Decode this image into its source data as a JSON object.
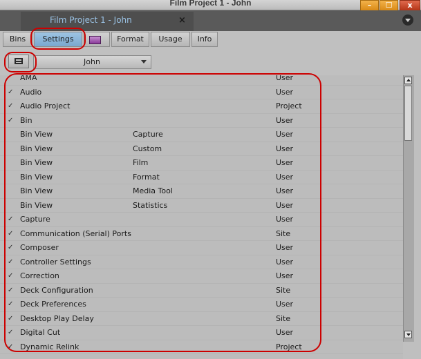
{
  "window": {
    "title": "Film Project 1 - John",
    "min_label": "–",
    "max_label": "☐",
    "close_label": "x"
  },
  "project_tab": {
    "label": "Film Project 1 - John",
    "close_label": "×"
  },
  "tabs": [
    {
      "label": "Bins"
    },
    {
      "label": "Settings"
    },
    {
      "label": ""
    },
    {
      "label": "Format"
    },
    {
      "label": "Usage"
    },
    {
      "label": "Info"
    }
  ],
  "user_select": {
    "value": "John"
  },
  "settings": [
    {
      "checked": false,
      "name": "AMA",
      "sub": "",
      "type": "User"
    },
    {
      "checked": true,
      "name": "Audio",
      "sub": "",
      "type": "User"
    },
    {
      "checked": true,
      "name": "Audio Project",
      "sub": "",
      "type": "Project"
    },
    {
      "checked": true,
      "name": "Bin",
      "sub": "",
      "type": "User"
    },
    {
      "checked": false,
      "name": "Bin View",
      "sub": "Capture",
      "type": "User"
    },
    {
      "checked": false,
      "name": "Bin View",
      "sub": "Custom",
      "type": "User"
    },
    {
      "checked": false,
      "name": "Bin View",
      "sub": "Film",
      "type": "User"
    },
    {
      "checked": false,
      "name": "Bin View",
      "sub": "Format",
      "type": "User"
    },
    {
      "checked": false,
      "name": "Bin View",
      "sub": "Media Tool",
      "type": "User"
    },
    {
      "checked": false,
      "name": "Bin View",
      "sub": "Statistics",
      "type": "User"
    },
    {
      "checked": true,
      "name": "Capture",
      "sub": "",
      "type": "User"
    },
    {
      "checked": true,
      "name": "Communication (Serial) Ports",
      "sub": "",
      "type": "Site"
    },
    {
      "checked": true,
      "name": "Composer",
      "sub": "",
      "type": "User"
    },
    {
      "checked": true,
      "name": "Controller Settings",
      "sub": "",
      "type": "User"
    },
    {
      "checked": true,
      "name": "Correction",
      "sub": "",
      "type": "User"
    },
    {
      "checked": true,
      "name": "Deck Configuration",
      "sub": "",
      "type": "Site"
    },
    {
      "checked": true,
      "name": "Deck Preferences",
      "sub": "",
      "type": "User"
    },
    {
      "checked": true,
      "name": "Desktop Play Delay",
      "sub": "",
      "type": "Site"
    },
    {
      "checked": true,
      "name": "Digital Cut",
      "sub": "",
      "type": "User"
    },
    {
      "checked": true,
      "name": "Dynamic Relink",
      "sub": "",
      "type": "Project"
    }
  ],
  "colors": {
    "annotation": "#cc0000",
    "active_tab": "#8db6da",
    "project_tab_text": "#9bc3e6"
  }
}
